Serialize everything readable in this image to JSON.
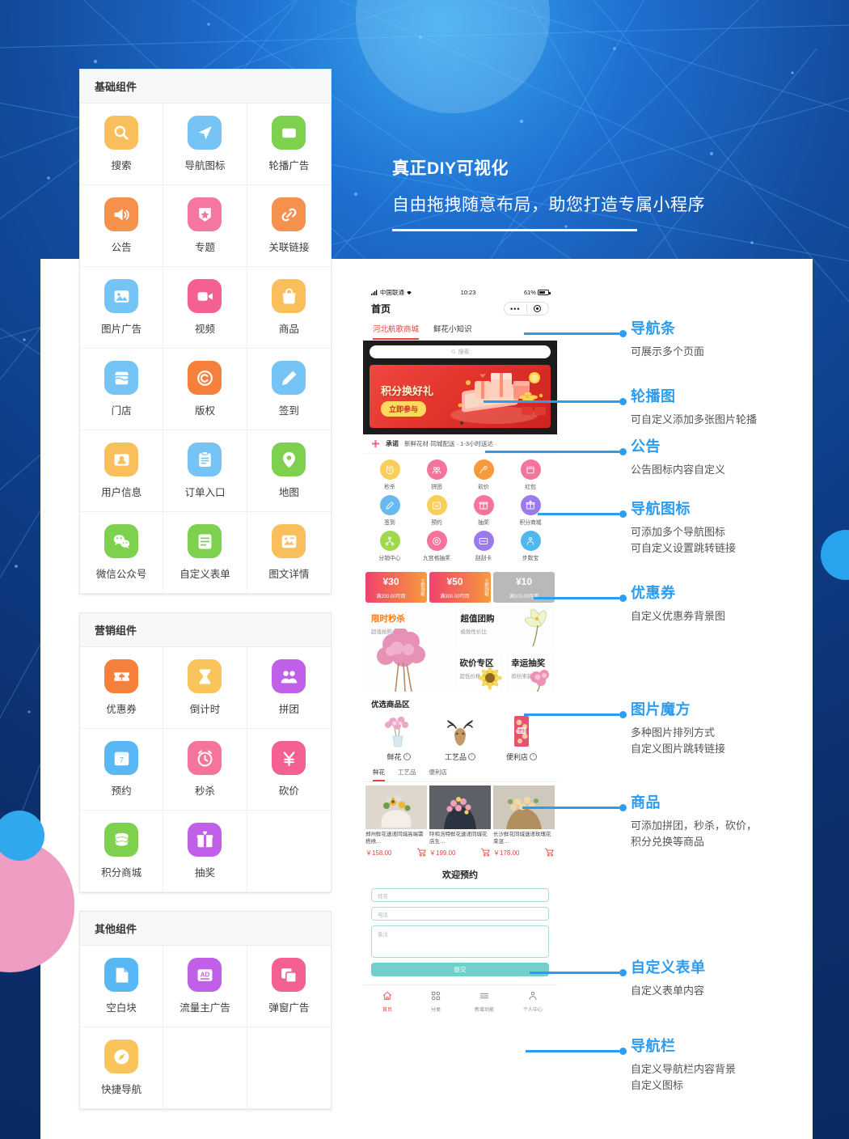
{
  "headline": {
    "line1": "真正DIY可视化",
    "line2": "自由拖拽随意布局，助您打造专属小程序"
  },
  "panels": [
    {
      "title": "基础组件",
      "items": [
        {
          "label": "搜索",
          "icon": "search-icon",
          "color": "#f9bf5c"
        },
        {
          "label": "导航图标",
          "icon": "navigation-arrow-icon",
          "color": "#76c4f5"
        },
        {
          "label": "轮播广告",
          "icon": "carousel-icon",
          "color": "#7ed04f"
        },
        {
          "label": "公告",
          "icon": "megaphone-icon",
          "color": "#f5914c"
        },
        {
          "label": "专题",
          "icon": "star-shield-icon",
          "color": "#f577a0"
        },
        {
          "label": "关联链接",
          "icon": "link-icon",
          "color": "#f5914c"
        },
        {
          "label": "图片广告",
          "icon": "image-icon",
          "color": "#76c4f5"
        },
        {
          "label": "视频",
          "icon": "video-camera-icon",
          "color": "#f4608f"
        },
        {
          "label": "商品",
          "icon": "shopping-bag-icon",
          "color": "#f9bf5c"
        },
        {
          "label": "门店",
          "icon": "store-icon",
          "color": "#76c4f5"
        },
        {
          "label": "版权",
          "icon": "copyright-icon",
          "color": "#f5803c"
        },
        {
          "label": "签到",
          "icon": "pencil-icon",
          "color": "#76c4f5"
        },
        {
          "label": "用户信息",
          "icon": "id-card-icon",
          "color": "#f9bf5c"
        },
        {
          "label": "订单入口",
          "icon": "clipboard-icon",
          "color": "#76c4f5"
        },
        {
          "label": "地图",
          "icon": "map-pin-icon",
          "color": "#7ed04f"
        },
        {
          "label": "微信公众号",
          "icon": "wechat-icon",
          "color": "#7ed04f"
        },
        {
          "label": "自定义表单",
          "icon": "form-lines-icon",
          "color": "#7ed04f"
        },
        {
          "label": "图文详情",
          "icon": "article-image-icon",
          "color": "#f9bf5c"
        }
      ]
    },
    {
      "title": "营销组件",
      "items": [
        {
          "label": "优惠券",
          "icon": "coupon-icon",
          "color": "#f5803c"
        },
        {
          "label": "倒计时",
          "icon": "hourglass-icon",
          "color": "#f9c45c"
        },
        {
          "label": "拼团",
          "icon": "group-people-icon",
          "color": "#c060e8"
        },
        {
          "label": "预约",
          "icon": "calendar-icon",
          "color": "#59b7f5"
        },
        {
          "label": "秒杀",
          "icon": "alarm-clock-icon",
          "color": "#f4749b"
        },
        {
          "label": "砍价",
          "icon": "yuan-icon",
          "color": "#f4608f"
        },
        {
          "label": "积分商城",
          "icon": "coins-stack-icon",
          "color": "#7ed04f"
        },
        {
          "label": "抽奖",
          "icon": "gift-icon",
          "color": "#c060e8"
        },
        {
          "label": "",
          "icon": "",
          "color": ""
        }
      ]
    },
    {
      "title": "其他组件",
      "items": [
        {
          "label": "空白块",
          "icon": "blank-page-icon",
          "color": "#59b7f5"
        },
        {
          "label": "流量主广告",
          "icon": "ad-icon",
          "color": "#c060e8"
        },
        {
          "label": "弹窗广告",
          "icon": "popup-window-icon",
          "color": "#f4608f"
        },
        {
          "label": "快捷导航",
          "icon": "compass-icon",
          "color": "#f9c45c"
        },
        {
          "label": "",
          "icon": "",
          "color": ""
        },
        {
          "label": "",
          "icon": "",
          "color": ""
        }
      ]
    }
  ],
  "phone": {
    "status": {
      "carrier": "中国联通",
      "time": "10:23",
      "battery": "61%"
    },
    "nav_title": "首页",
    "tabs": [
      {
        "label": "河北航歌商城",
        "active": true
      },
      {
        "label": "鲜花小知识",
        "active": false
      }
    ],
    "search_placeholder": "搜索",
    "banner": {
      "title": "积分换好礼",
      "button": "立即参与"
    },
    "notice": {
      "badge": "承诺",
      "text": "新鲜花材·同城配送 · 1-3小时送达 ·"
    },
    "nav_icons": [
      {
        "label": "秒杀",
        "icon": "alarm-clock-icon",
        "color": "#f7cf5a"
      },
      {
        "label": "拼团",
        "icon": "group-people-icon",
        "color": "#f4749b"
      },
      {
        "label": "砍价",
        "icon": "axe-icon",
        "color": "#f79a3c"
      },
      {
        "label": "红包",
        "icon": "red-packet-icon",
        "color": "#f4749b"
      },
      {
        "label": "签到",
        "icon": "pencil-icon",
        "color": "#68b9ef"
      },
      {
        "label": "预约",
        "icon": "check-box-icon",
        "color": "#f7cf5a"
      },
      {
        "label": "抽奖",
        "icon": "lottery-box-icon",
        "color": "#f4749b"
      },
      {
        "label": "积分商城",
        "icon": "gift-icon",
        "color": "#9b7bec"
      },
      {
        "label": "分销中心",
        "icon": "share-tree-icon",
        "color": "#9fd84f"
      },
      {
        "label": "九宫格抽奖",
        "icon": "wheel-icon",
        "color": "#f4749b"
      },
      {
        "label": "刮刮卡",
        "icon": "scratch-card-icon",
        "color": "#9b7bec"
      },
      {
        "label": "步数宝",
        "icon": "user-walk-icon",
        "color": "#4fb8ef"
      }
    ],
    "coupons": [
      {
        "amount": "¥30",
        "cond": "满200.00可用",
        "get": "立即领取",
        "style": "c1"
      },
      {
        "amount": "¥50",
        "cond": "满300.00可用",
        "get": "立即领取",
        "style": "c2"
      },
      {
        "amount": "¥10",
        "cond": "满100.00可用",
        "get": "立即领取",
        "style": "c3"
      }
    ],
    "cube": [
      {
        "title": "限时秒杀",
        "sub": "超值抢购"
      },
      {
        "title": "超值团购",
        "sub": "极致性价比"
      },
      {
        "title": "砍价专区",
        "sub": "超低价格"
      },
      {
        "title": "幸运抽奖",
        "sub": "缤纷来装"
      }
    ],
    "section_title": "优选商品区",
    "categories": [
      {
        "label": "鲜花"
      },
      {
        "label": "工艺品"
      },
      {
        "label": "便利店"
      }
    ],
    "subtabs": [
      {
        "label": "鲜花",
        "active": true
      },
      {
        "label": "工艺品",
        "active": false
      },
      {
        "label": "便利店",
        "active": false
      }
    ],
    "products": [
      {
        "title": "郑州鲜花速递同城高端需搭绣…",
        "price": "￥158.00"
      },
      {
        "title": "呼和浩特鲜花速递同城花店生…",
        "price": "￥199.00"
      },
      {
        "title": "长沙鲜花同城速递玫瑰花束混…",
        "price": "￥178.00"
      }
    ],
    "form": {
      "title": "欢迎预约",
      "name_placeholder": "姓名",
      "phone_placeholder": "电话",
      "remark_placeholder": "备注",
      "submit": "提交"
    },
    "bottom_nav": [
      {
        "label": "首页",
        "icon": "home-icon",
        "active": true
      },
      {
        "label": "分类",
        "icon": "grid-icon",
        "active": false
      },
      {
        "label": "新增功能",
        "icon": "menu-lines-icon",
        "active": false
      },
      {
        "label": "个人中心",
        "icon": "person-icon",
        "active": false
      }
    ]
  },
  "annotations": [
    {
      "title": "导航条",
      "desc": "可展示多个页面"
    },
    {
      "title": "轮播图",
      "desc": "可自定义添加多张图片轮播"
    },
    {
      "title": "公告",
      "desc": "公告图标内容自定义"
    },
    {
      "title": "导航图标",
      "desc": "可添加多个导航图标\n可自定义设置跳转链接"
    },
    {
      "title": "优惠券",
      "desc": "自定义优惠券背景图"
    },
    {
      "title": "图片魔方",
      "desc": "多种图片排列方式\n自定义图片跳转链接"
    },
    {
      "title": "商品",
      "desc": "可添加拼团，秒杀，砍价，\n积分兑换等商品"
    },
    {
      "title": "自定义表单",
      "desc": "自定义表单内容"
    },
    {
      "title": "导航栏",
      "desc": "自定义导航栏内容背景\n自定义图标"
    }
  ],
  "colors": {
    "accent": "#2b9cf0",
    "bg_blue": "#0b3a8f",
    "red": "#e8443a",
    "teal": "#73cfc9"
  }
}
